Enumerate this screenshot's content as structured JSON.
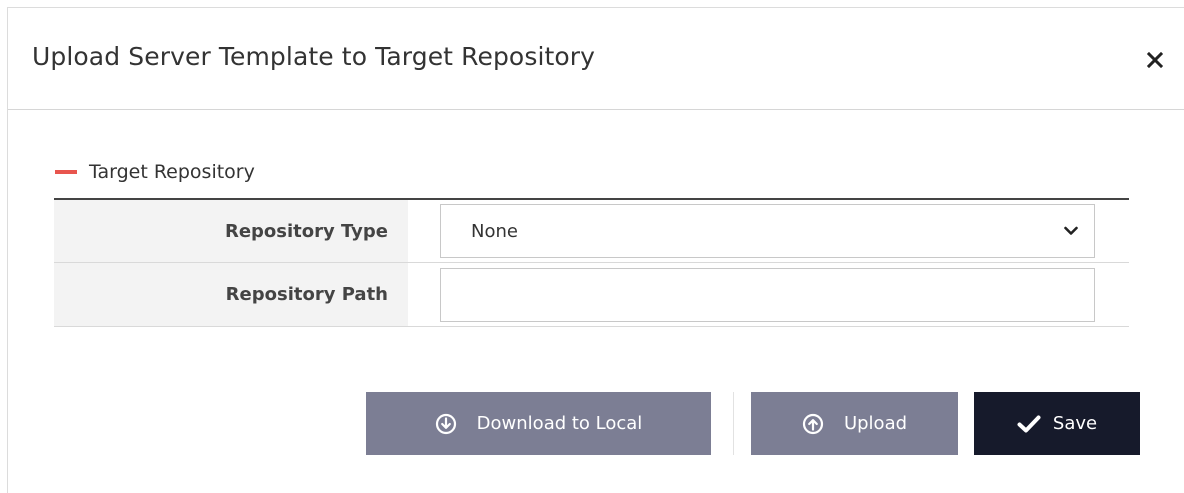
{
  "dialog": {
    "title": "Upload Server Template to Target Repository"
  },
  "section": {
    "title": "Target Repository",
    "accent_color": "#e8554e"
  },
  "form": {
    "repository_type": {
      "label": "Repository Type",
      "value": "None"
    },
    "repository_path": {
      "label": "Repository Path",
      "value": "",
      "placeholder": ""
    }
  },
  "buttons": {
    "download": {
      "label": "Download to Local",
      "icon": "arrow-down-circle-icon"
    },
    "upload": {
      "label": "Upload",
      "icon": "arrow-up-circle-icon"
    },
    "save": {
      "label": "Save",
      "icon": "checkmark-icon"
    }
  },
  "colors": {
    "button_gray": "#7c7e94",
    "button_dark": "#161a2b"
  }
}
